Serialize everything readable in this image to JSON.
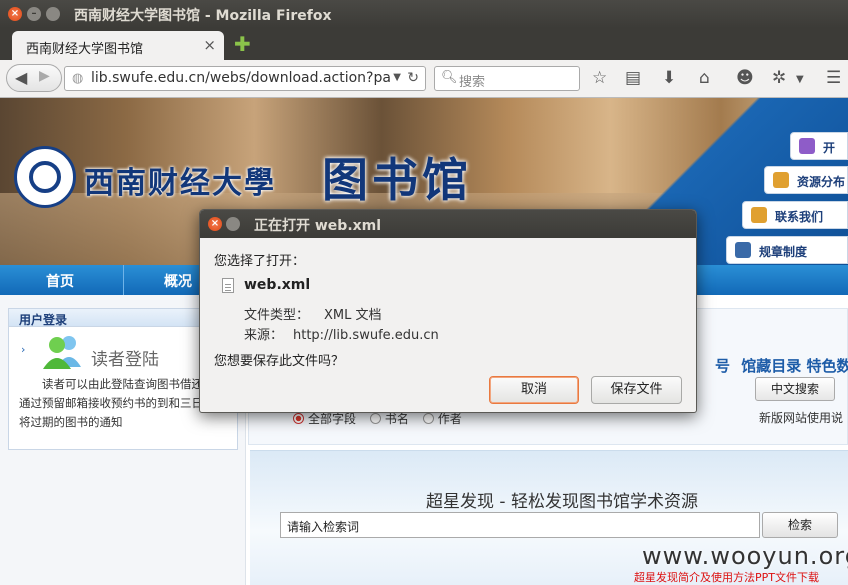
{
  "window": {
    "title": "西南财经大学图书馆 - Mozilla Firefox"
  },
  "tab": {
    "title": "西南财经大学图书馆",
    "close": "×",
    "new_tab": "✚"
  },
  "navbar": {
    "url": "lib.swufe.edu.cn/webs/download.action?pat",
    "search_placeholder": "搜索"
  },
  "banner": {
    "univ_name": "西南财经大學",
    "lib_name": "图书馆",
    "side_buttons": [
      {
        "label": "开",
        "icon": "book-icon",
        "color": "#8e5cc8"
      },
      {
        "label": "资源分布",
        "icon": "resources-icon",
        "color": "#e0a030"
      },
      {
        "label": "联系我们",
        "icon": "mail-icon",
        "color": "#e0a030"
      },
      {
        "label": "规章制度",
        "icon": "rules-icon",
        "color": "#3a6aa8"
      }
    ]
  },
  "menu": {
    "items": [
      "首页",
      "概况"
    ]
  },
  "login": {
    "header": "用户登录",
    "title": "读者登陆",
    "text": "读者可以由此登陆查询图书借还并可通过预留邮箱接收预约书的到和三日内即将过期的图书的通知"
  },
  "search": {
    "tabs_text": "馆藏目录  特色数",
    "lead_char": "号",
    "chinese_search": "中文搜索",
    "new_site_note": "新版网站使用说",
    "radios": [
      "全部字段",
      "书名",
      "作者"
    ]
  },
  "chaoxing": {
    "title": "超星发现 - 轻松发现图书馆学术资源",
    "input_value": "请输入检索词",
    "button": "检索"
  },
  "watermark": {
    "site": "www.wooyun.org",
    "caption": "超星发现简介及使用方法PPT文件下载"
  },
  "dialog": {
    "title": "正在打开 web.xml",
    "chose": "您选择了打开：",
    "filename": "web.xml",
    "type_label": "文件类型：",
    "type_value": "XML 文档",
    "source_label": "来源：",
    "source_value": "http://lib.swufe.edu.cn",
    "question": "您想要保存此文件吗？",
    "cancel": "取消",
    "save": "保存文件"
  }
}
